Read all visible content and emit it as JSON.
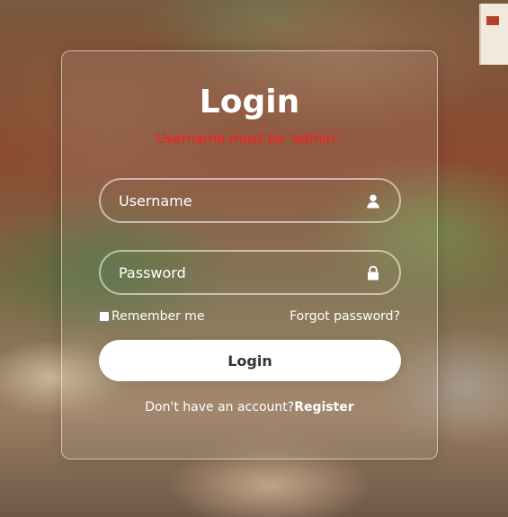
{
  "form": {
    "title": "Login",
    "error_message": "Username must be 'admin'.",
    "username": {
      "placeholder": "Username",
      "value": "",
      "icon": "user-icon"
    },
    "password": {
      "placeholder": "Password",
      "value": "",
      "icon": "lock-icon"
    },
    "remember_label": "Remember me",
    "remember_checked": false,
    "forgot_label": "Forgot password?",
    "login_label": "Login",
    "register_prompt": "Don't have an account?",
    "register_label": "Register"
  },
  "colors": {
    "error": "#ff1a1a",
    "text": "#ffffff",
    "button_bg": "#ffffff",
    "button_text": "#333333"
  }
}
